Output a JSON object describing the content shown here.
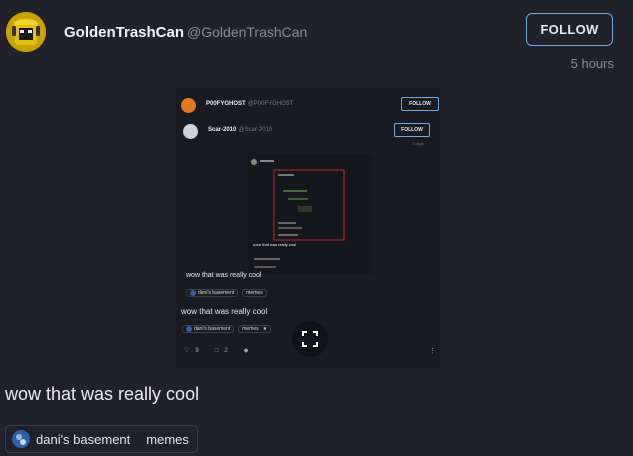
{
  "post": {
    "author": "GoldenTrashCan",
    "handle": "@GoldenTrashCan",
    "follow_label": "FOLLOW",
    "time": "5 hours",
    "text": "wow that was really cool",
    "tags": [
      "dani's basement",
      "memes"
    ]
  },
  "embed": {
    "author1": "P00FYGHOST",
    "author1_handle": "@P00FYGHOST",
    "author2": "Scar-2010",
    "author2_handle": "@Scar-2010",
    "author2_time": "7 days",
    "follow_label": "FOLLOW",
    "deep_text": "wow that was really cool",
    "inner_text": "wow that was really cool",
    "inner_tags": [
      "dani's basement",
      "memes"
    ],
    "outer_text": "wow that was really cool",
    "outer_tags": [
      "dani's basement",
      "memes"
    ],
    "like_count": "9",
    "comment_count": "2"
  },
  "colors": {
    "background": "#20212a",
    "accent": "#6fa9e6",
    "avatar": "#c9a400"
  }
}
